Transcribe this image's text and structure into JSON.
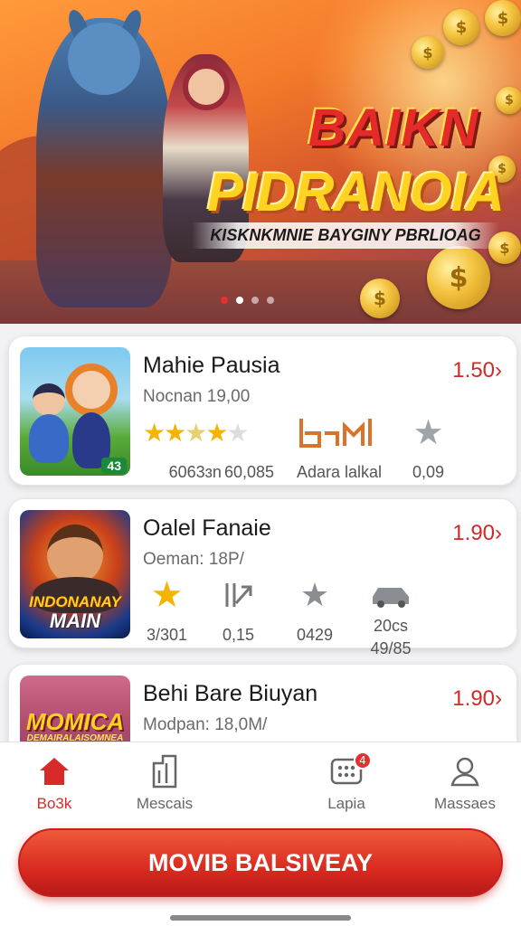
{
  "banner": {
    "title_line1": "BAIKN",
    "title_line2": "PIDRANOIA",
    "subtitle": "KISKNKMNIE BAYGINY PBRLIOAG",
    "page_count": 4,
    "active_page": 2
  },
  "cards": [
    {
      "name": "Mahie Pausia",
      "meta": "Nocnan 19,00",
      "price": "1.50›",
      "thumb_badge": "43",
      "stats": [
        {
          "icon": "rating-stars-icon",
          "value": "6063ɜn"
        },
        {
          "icon": "rating-stars-icon",
          "value": "60,085"
        },
        {
          "icon": "chart-logo-icon",
          "value": "Adara lalkal"
        },
        {
          "icon": "gray-star-icon",
          "value": "0,09"
        }
      ]
    },
    {
      "name": "Oalel Fanaie",
      "meta": "Oeman: 18P/",
      "price": "1.90›",
      "thumb_text_line1": "INDONANAY",
      "thumb_text_line2": "MAIN",
      "stats": [
        {
          "icon": "gold-star-icon",
          "value": "3/301"
        },
        {
          "icon": "arrow-chart-icon",
          "value": "0,15"
        },
        {
          "icon": "gray-star-icon",
          "value": "0429"
        },
        {
          "icon": "car-icon",
          "value": "49/85",
          "top_label": "20cs"
        }
      ]
    },
    {
      "name": "Behi Bare Biuyan",
      "meta": "Modpan: 18,0M/",
      "price": "1.90›",
      "thumb_text_line1": "MOMICA",
      "thumb_text_line2": "DEMAIRALAISOMNEA"
    }
  ],
  "nav": [
    {
      "label": "Bo3k",
      "icon": "home-icon",
      "active": true
    },
    {
      "label": "Mescais",
      "icon": "building-icon",
      "active": false
    },
    {
      "label": "Lapia",
      "icon": "dice-icon",
      "active": false,
      "badge": "4"
    },
    {
      "label": "Massaes",
      "icon": "user-icon",
      "active": false
    }
  ],
  "cta_label": "MOVIB BALSIVEAY",
  "colors": {
    "accent": "#d92a2a",
    "price": "#cf2a2a",
    "star": "#f4b400"
  }
}
